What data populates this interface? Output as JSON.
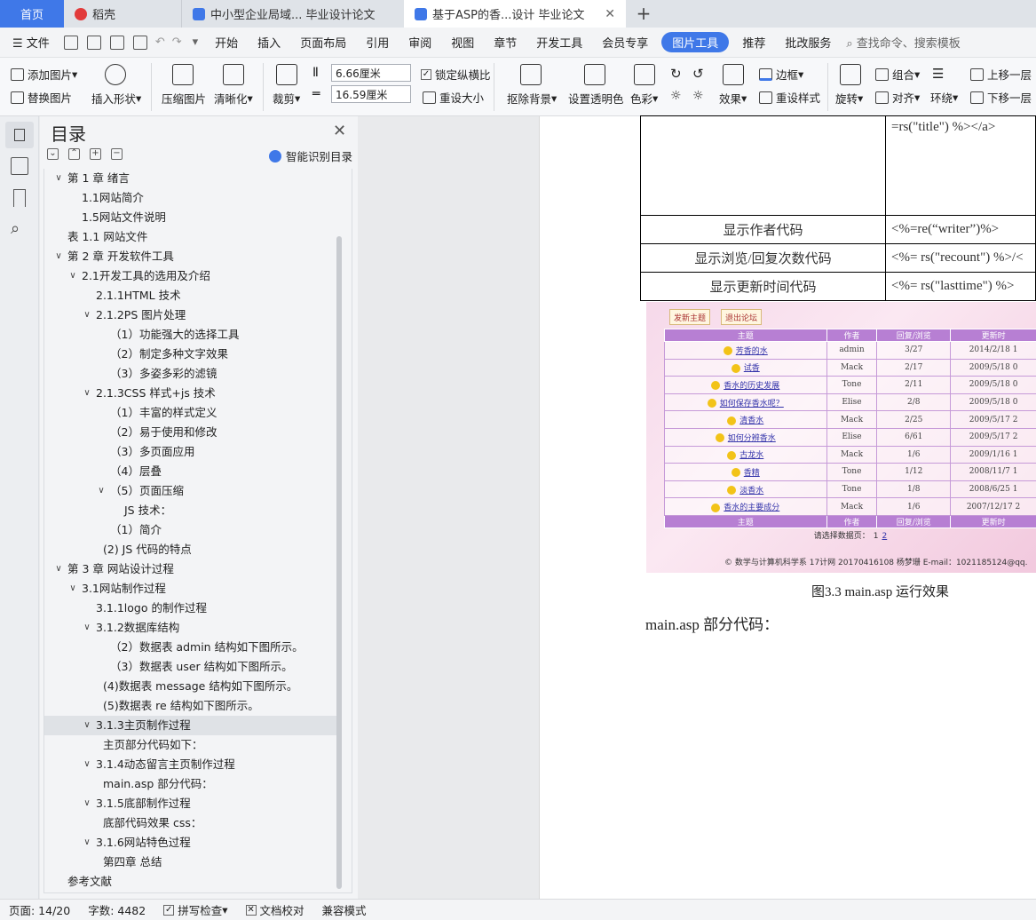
{
  "tabs": {
    "home": "首页",
    "t1": "稻壳",
    "t2": "中小型企业局域... 毕业设计论文",
    "t3": "基于ASP的香...设计 毕业论文",
    "new": "+"
  },
  "menu": {
    "file": "文件",
    "items": [
      "开始",
      "插入",
      "页面布局",
      "引用",
      "审阅",
      "视图",
      "章节",
      "开发工具",
      "会员专享"
    ],
    "active": "图片工具",
    "items2": [
      "推荐",
      "批改服务"
    ],
    "search": "查找命令、搜索模板"
  },
  "ribbon": {
    "add_image": "添加图片",
    "replace_image": "替换图片",
    "insert_shape": "插入形状",
    "compress": "压缩图片",
    "clarify": "清晰化",
    "crop": "裁剪",
    "width": "6.66厘米",
    "height": "16.59厘米",
    "lock_ratio": "锁定纵横比",
    "resize": "重设大小",
    "remove_bg": "抠除背景",
    "set_transparent": "设置透明色",
    "color": "色彩",
    "effect": "效果",
    "border": "边框",
    "reset_style": "重设样式",
    "rotate": "旋转",
    "group": "组合",
    "align": "对齐",
    "wrap": "环绕",
    "bring_forward": "上移一层",
    "send_backward": "下移一层"
  },
  "toc": {
    "title": "目录",
    "smart": "智能识别目录",
    "items": [
      {
        "text": "第 1 章 绪言",
        "indent": 0,
        "arrow": "down"
      },
      {
        "text": "1.1网站简介",
        "indent": 1,
        "arrow": ""
      },
      {
        "text": "1.5网站文件说明",
        "indent": 1,
        "arrow": ""
      },
      {
        "text": "表 1.1 网站文件",
        "indent": 0,
        "arrow": ""
      },
      {
        "text": "第 2 章 开发软件工具",
        "indent": 0,
        "arrow": "down"
      },
      {
        "text": "2.1开发工具的选用及介绍",
        "indent": 1,
        "arrow": "down"
      },
      {
        "text": "2.1.1HTML 技术",
        "indent": 2,
        "arrow": ""
      },
      {
        "text": "2.1.2PS 图片处理",
        "indent": 2,
        "arrow": "down"
      },
      {
        "text": "（1）功能强大的选择工具",
        "indent": 3,
        "arrow": ""
      },
      {
        "text": "（2）制定多种文字效果",
        "indent": 3,
        "arrow": ""
      },
      {
        "text": "（3）多姿多彩的滤镜",
        "indent": 3,
        "arrow": ""
      },
      {
        "text": "2.1.3CSS 样式+js 技术",
        "indent": 2,
        "arrow": "down"
      },
      {
        "text": "（1）丰富的样式定义",
        "indent": 3,
        "arrow": ""
      },
      {
        "text": "（2）易于使用和修改",
        "indent": 3,
        "arrow": ""
      },
      {
        "text": "（3）多页面应用",
        "indent": 3,
        "arrow": ""
      },
      {
        "text": "（4）层叠",
        "indent": 3,
        "arrow": ""
      },
      {
        "text": "（5）页面压缩",
        "indent": 3,
        "arrow": "down"
      },
      {
        "text": "JS 技术：",
        "indent": 4,
        "arrow": ""
      },
      {
        "text": "（1）简介",
        "indent": 3,
        "arrow": ""
      },
      {
        "text": "(2) JS 代码的特点",
        "indent": 2.5,
        "arrow": ""
      },
      {
        "text": "第 3 章 网站设计过程",
        "indent": 0,
        "arrow": "down"
      },
      {
        "text": "3.1网站制作过程",
        "indent": 1,
        "arrow": "down"
      },
      {
        "text": "3.1.1logo 的制作过程",
        "indent": 2,
        "arrow": ""
      },
      {
        "text": "3.1.2数据库结构",
        "indent": 2,
        "arrow": "down"
      },
      {
        "text": "（2）数据表 admin 结构如下图所示。",
        "indent": 3,
        "arrow": ""
      },
      {
        "text": "（3）数据表 user 结构如下图所示。",
        "indent": 3,
        "arrow": ""
      },
      {
        "text": "(4)数据表 message 结构如下图所示。",
        "indent": 2.5,
        "arrow": ""
      },
      {
        "text": "(5)数据表 re 结构如下图所示。",
        "indent": 2.5,
        "arrow": ""
      },
      {
        "text": "3.1.3主页制作过程",
        "indent": 2,
        "arrow": "down",
        "selected": true
      },
      {
        "text": "主页部分代码如下：",
        "indent": 2.5,
        "arrow": ""
      },
      {
        "text": "3.1.4动态留言主页制作过程",
        "indent": 2,
        "arrow": "down"
      },
      {
        "text": "main.asp 部分代码：",
        "indent": 2.5,
        "arrow": ""
      },
      {
        "text": "3.1.5底部制作过程",
        "indent": 2,
        "arrow": "down"
      },
      {
        "text": "底部代码效果 css：",
        "indent": 2.5,
        "arrow": ""
      },
      {
        "text": "3.1.6网站特色过程",
        "indent": 2,
        "arrow": "down"
      },
      {
        "text": "第四章 总结",
        "indent": 2.5,
        "arrow": ""
      },
      {
        "text": "参考文献",
        "indent": 0,
        "arrow": ""
      }
    ]
  },
  "doc": {
    "code_rows": [
      {
        "left": "",
        "right": "=rs(\"title\") %></a>"
      },
      {
        "left": "显示作者代码",
        "right": "<%=re(“writer”)%>"
      },
      {
        "left": "显示浏览/回复次数代码",
        "right": "<%= rs(\"recount\") %>/<"
      },
      {
        "left": "显示更新时间代码",
        "right": "<%= rs(\"lasttime\") %>"
      }
    ],
    "forum": {
      "btn_new": "发新主题",
      "btn_exit": "退出论坛",
      "headers": [
        "主题",
        "作者",
        "回复/浏览",
        "更新时"
      ],
      "rows": [
        {
          "title": "芳香的水",
          "author": "admin",
          "count": "3/27",
          "time": "2014/2/18 1"
        },
        {
          "title": "试香",
          "author": "Mack",
          "count": "2/17",
          "time": "2009/5/18 0"
        },
        {
          "title": "香水的历史发展",
          "author": "Tone",
          "count": "2/11",
          "time": "2009/5/18 0"
        },
        {
          "title": "如何保存香水呢？",
          "author": "Elise",
          "count": "2/8",
          "time": "2009/5/18 0"
        },
        {
          "title": "清香水",
          "author": "Mack",
          "count": "2/25",
          "time": "2009/5/17 2"
        },
        {
          "title": "如何分辨香水",
          "author": "Elise",
          "count": "6/61",
          "time": "2009/5/17 2"
        },
        {
          "title": "古龙水",
          "author": "Mack",
          "count": "1/6",
          "time": "2009/1/16 1"
        },
        {
          "title": "香精",
          "author": "Tone",
          "count": "1/12",
          "time": "2008/11/7 1"
        },
        {
          "title": "淡香水",
          "author": "Tone",
          "count": "1/8",
          "time": "2008/6/25 1"
        },
        {
          "title": "香水的主要成分",
          "author": "Mack",
          "count": "1/6",
          "time": "2007/12/17 2"
        }
      ],
      "pager_label": "请选择数据页：",
      "pages": [
        "1",
        "2"
      ],
      "footer": "© 数学与计算机科学系 17计网 20170416108 杨梦珊 E-mail：1021185124@qq."
    },
    "caption": "图3.3    main.asp 运行效果",
    "para": "main.asp 部分代码："
  },
  "status": {
    "page": "页面: 14/20",
    "words": "字数: 4482",
    "spell": "拼写检查",
    "proof": "文档校对",
    "compat": "兼容模式"
  },
  "colors": {
    "accent": "#3f78e8",
    "forum_header": "#b77fd3"
  }
}
